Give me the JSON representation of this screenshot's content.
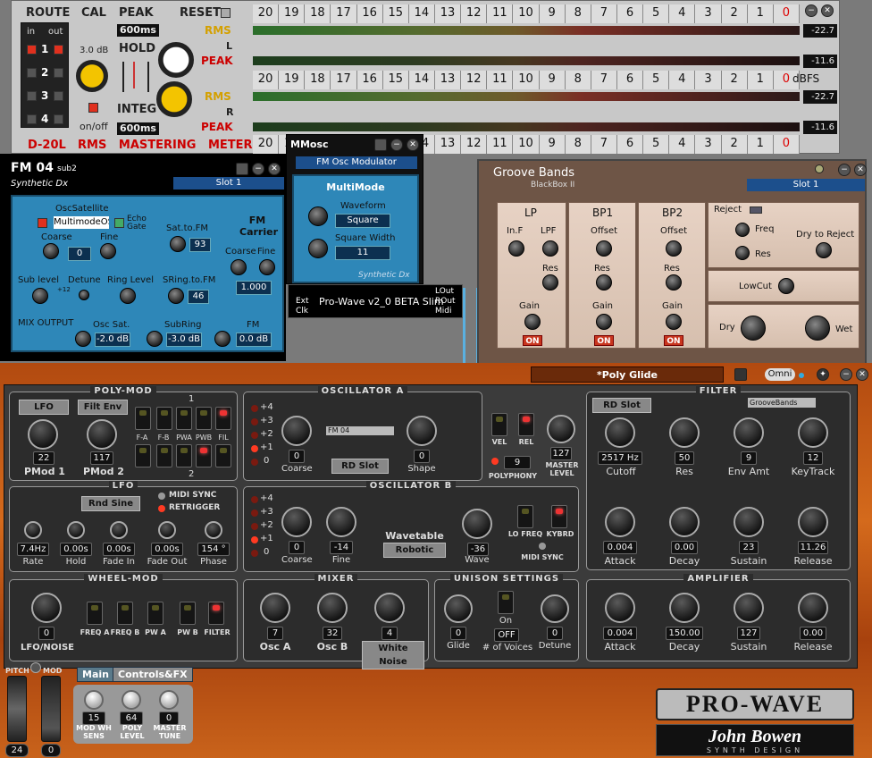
{
  "rms": {
    "route": "ROUTE",
    "cal": "CAL",
    "peak": "PEAK",
    "reset": "RESET",
    "in": "in",
    "out": "out",
    "ch": [
      "1",
      "2",
      "3",
      "4"
    ],
    "cal_val": "3.0 dB",
    "hold": "HOLD",
    "integ": "INTEG",
    "onoff": "on/off",
    "ms1": "600ms",
    "ms2": "600ms",
    "ms3": "600ms",
    "title": "D-20L",
    "subtitle": "RMS   MASTERING   METER",
    "scale": [
      "20",
      "19",
      "18",
      "17",
      "16",
      "15",
      "14",
      "13",
      "12",
      "11",
      "10",
      "9",
      "8",
      "7",
      "6",
      "5",
      "4",
      "3",
      "2",
      "1",
      "0"
    ],
    "rms_lbl": "RMS",
    "peak_lbl": "PEAK",
    "L": "L",
    "R": "R",
    "dbfs": "dBFS",
    "vals": [
      "-22.7",
      "-11.6",
      "-22.7",
      "-11.6"
    ]
  },
  "fm": {
    "title": "FM 04",
    "sub": "sub2",
    "subtitle": "Synthetic Dx",
    "slot": "Slot 1",
    "osc_sat": "OscSatellite",
    "osc_input": "MultimodeOSC",
    "echo": "Echo",
    "gate": "Gate",
    "coarse": "Coarse",
    "fine": "Fine",
    "coarse_val": "0",
    "sat_fm": "Sat.to.FM",
    "sat_val": "93",
    "carrier": "FM Carrier",
    "coarse2": "Coarse",
    "fine2": "Fine",
    "carrier_val": "1.000",
    "sub_level": "Sub level",
    "detune": "Detune",
    "plus12": "+12",
    "ring": "Ring Level",
    "sring": "SRing.to.FM",
    "sring_val": "46",
    "mix": "MIX OUTPUT",
    "osc_sat2": "Osc Sat.",
    "osc_sat_val": "-2.0 dB",
    "subring": "SubRing",
    "subring_val": "-3.0 dB",
    "fm_lbl": "FM",
    "fm_val": "0.0 dB"
  },
  "mmosc": {
    "title": "MMosc",
    "sub": "FM Osc Modulator",
    "mode": "MultiMode",
    "wave": "Waveform",
    "wave_val": "Square",
    "width": "Square Width",
    "width_val": "11",
    "footer": "Synthetic Dx",
    "route_name": "Pro-Wave v2_0 BETA Slim",
    "ext": "Ext",
    "clk": "Clk",
    "lout": "LOut",
    "rout": "ROut",
    "midi": "Midi"
  },
  "groove": {
    "title": "Groove Bands",
    "sub": "BlackBox II",
    "slot": "Slot 1",
    "lp": "LP",
    "inf": "In.F",
    "lpf": "LPF",
    "res": "Res",
    "gain": "Gain",
    "on": "ON",
    "bp1": "BP1",
    "bp2": "BP2",
    "offset": "Offset",
    "reject": "Reject",
    "freq": "Freq",
    "dry_rej": "Dry to Reject",
    "lowcut": "LowCut",
    "dry": "Dry",
    "wet": "Wet"
  },
  "pw": {
    "preset": "*Poly Glide",
    "omni": "Omni",
    "polymod": "POLY-MOD",
    "lfo_btn": "LFO",
    "filt_env": "Filt Env",
    "pmod1": "PMod 1",
    "pmod1_val": "22",
    "pmod2": "PMod 2",
    "pmod2_val": "117",
    "pm_sw_labels": [
      "F-A",
      "F-B",
      "PWA",
      "PWB",
      "FIL"
    ],
    "dash1": "1",
    "dash2": "2",
    "osca": "OSCILLATOR A",
    "octs": [
      "+4",
      "+3",
      "+2",
      "+1",
      "0"
    ],
    "coarse": "Coarse",
    "coarse_a": "0",
    "slot_name": "FM 04",
    "rd_slot": "RD Slot",
    "shape": "Shape",
    "shape_val": "0",
    "vel": "VEL",
    "rel": "REL",
    "poly": "POLYPHONY",
    "poly_val": "9",
    "master": "MASTER LEVEL",
    "master_val": "127",
    "filter": "FILTER",
    "f_rd": "RD Slot",
    "f_slot": "GrooveBands",
    "cutoff": "Cutoff",
    "cutoff_val": "2517 Hz",
    "res": "Res",
    "res_val": "50",
    "envamt": "Env Amt",
    "envamt_val": "9",
    "keytrack": "KeyTrack",
    "keytrack_val": "12",
    "f_attack": "0.004",
    "f_decay": "0.00",
    "f_sustain": "23",
    "f_release": "11.26",
    "attack": "Attack",
    "decay": "Decay",
    "sustain": "Sustain",
    "release": "Release",
    "lfo": "LFO",
    "rnd": "Rnd Sine",
    "midisync": "MIDI SYNC",
    "retrig": "RETRIGGER",
    "lfo_labels": [
      "Rate",
      "Hold",
      "Fade In",
      "Fade Out",
      "Phase"
    ],
    "lfo_vals": [
      "7.4Hz",
      "0.00s",
      "0.00s",
      "0.00s",
      "154 °"
    ],
    "oscb": "OSCILLATOR B",
    "coarse_b": "0",
    "fine": "Fine",
    "fine_b": "-14",
    "wavetable": "Wavetable",
    "robotic": "Robotic",
    "wave": "Wave",
    "wave_val": "-36",
    "lofreq": "LO FREQ",
    "kybrd": "KYBRD",
    "midisync2": "MIDI SYNC",
    "wheel": "WHEEL-MOD",
    "lfonoise": "LFO/NOISE",
    "wheel_val": "0",
    "wheel_labels": [
      "FREQ A",
      "FREQ B",
      "PW A",
      "PW B",
      "FILTER"
    ],
    "mixer": "MIXER",
    "osca_lbl": "Osc A",
    "osca_val": "7",
    "oscb_lbl": "Osc B",
    "oscb_val": "32",
    "noise": "White Noise",
    "noise_val": "4",
    "unison": "UNISON SETTINGS",
    "glide": "Glide",
    "glide_val": "0",
    "voices": "# of Voices",
    "voices_on": "On",
    "voices_val": "OFF",
    "detune": "Detune",
    "detune_val": "0",
    "amp": "AMPLIFIER",
    "a_attack": "0.004",
    "a_decay": "150.00",
    "a_sustain": "127",
    "a_release": "0.00",
    "pitch": "PITCH",
    "mod": "MOD",
    "pitch_val": "24",
    "mod_val": "0",
    "main": "Main",
    "ctrlfx": "Controls&FX",
    "modwh": "MOD WH SENS",
    "modwh_val": "15",
    "polylvl": "POLY LEVEL",
    "polylvl_val": "64",
    "mtune": "MASTER TUNE",
    "mtune_val": "0",
    "logo": "PRO-WAVE",
    "brand": "John Bowen",
    "brand_sub": "SYNTH DESIGN"
  }
}
